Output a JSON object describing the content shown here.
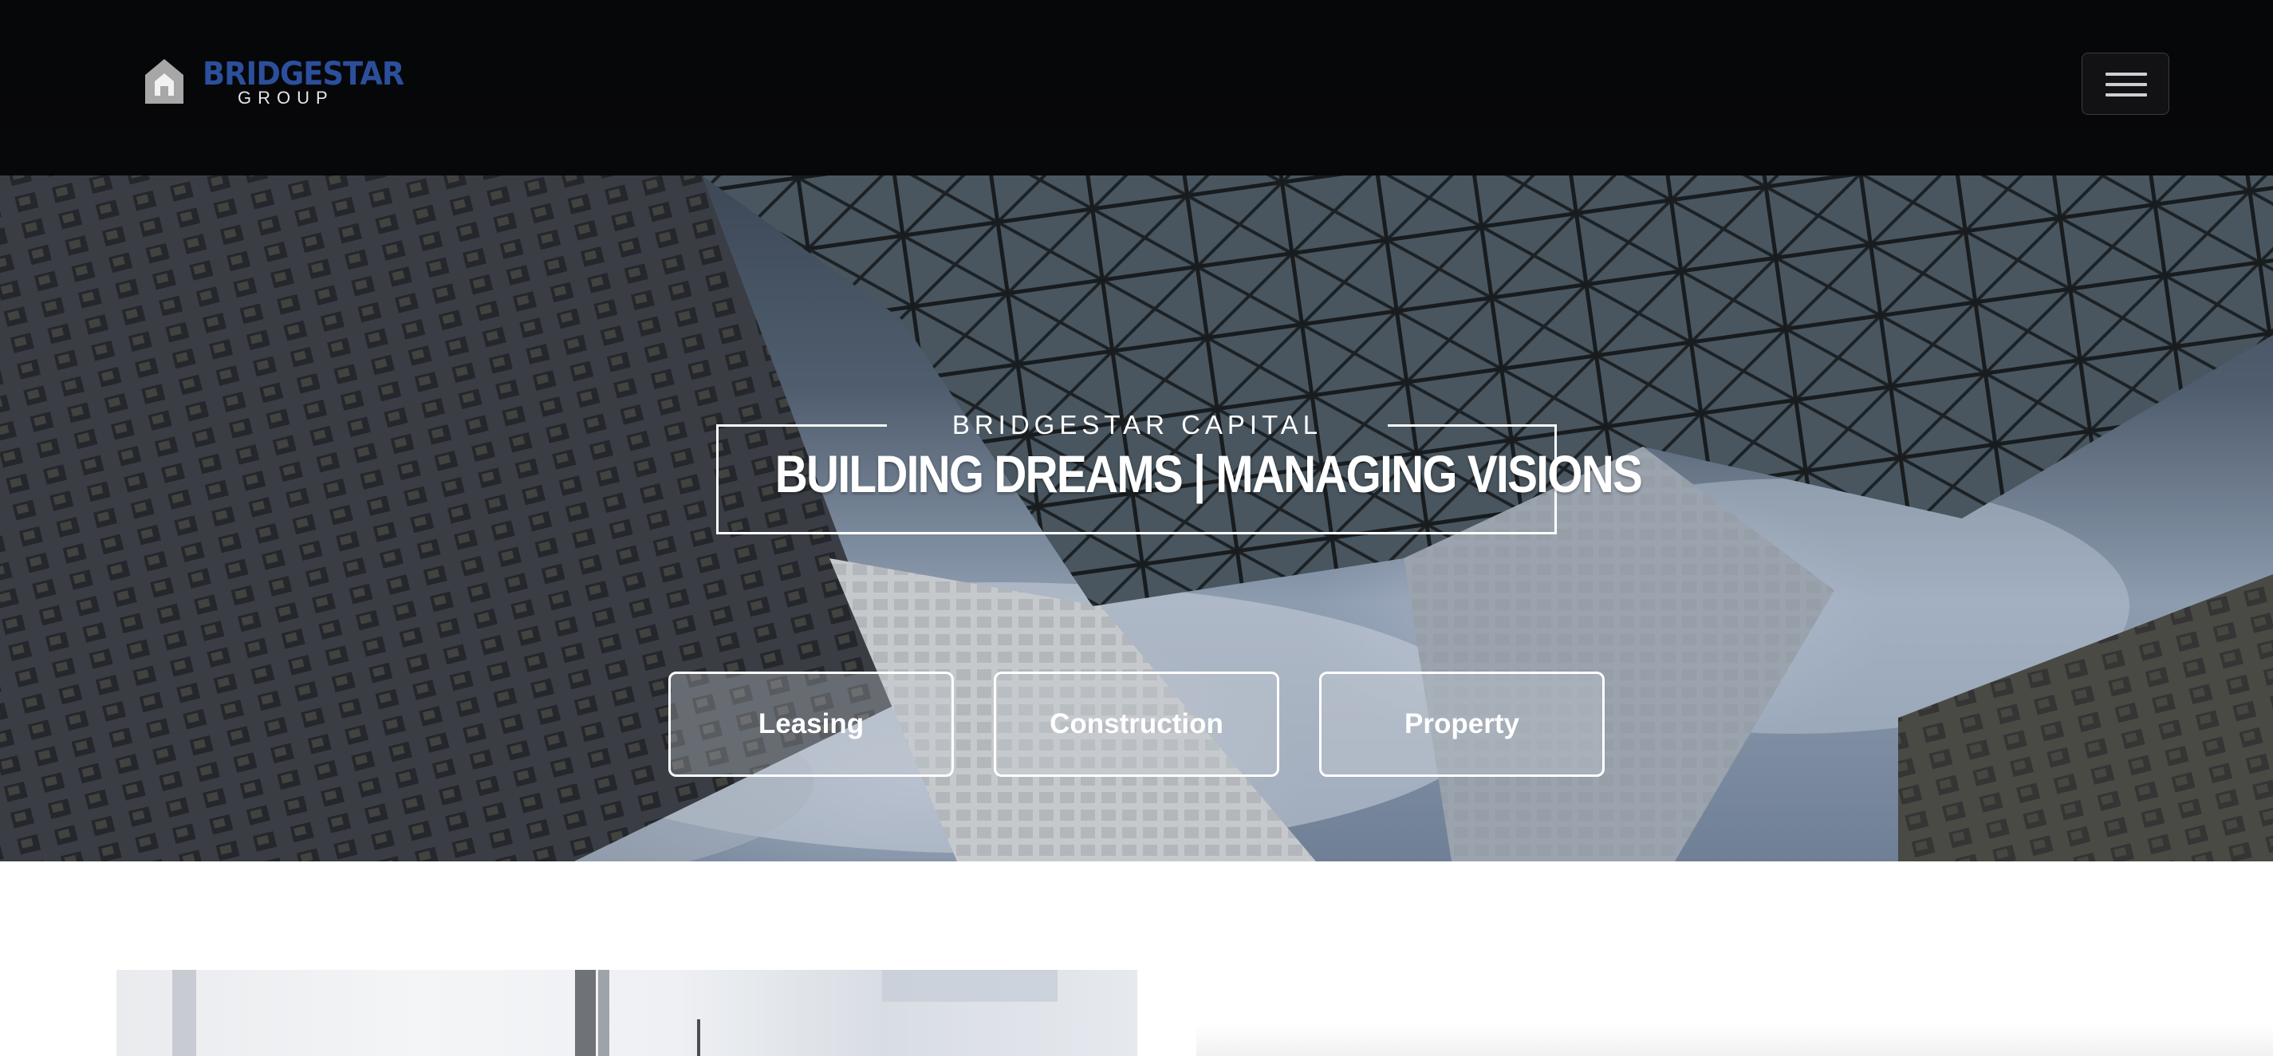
{
  "brand": {
    "name": "BRIDGESTAR",
    "sub": "GROUP",
    "brand_color": "#2c4f9c",
    "mark_icon": "house-logo-icon"
  },
  "nav": {
    "menu_icon": "hamburger-menu-icon"
  },
  "hero": {
    "kicker": "BRIDGESTAR CAPITAL",
    "headline": "BUILDING DREAMS | MANAGING VISIONS",
    "buttons": [
      {
        "label": "Leasing"
      },
      {
        "label": "Construction"
      },
      {
        "label": "Property"
      }
    ]
  }
}
